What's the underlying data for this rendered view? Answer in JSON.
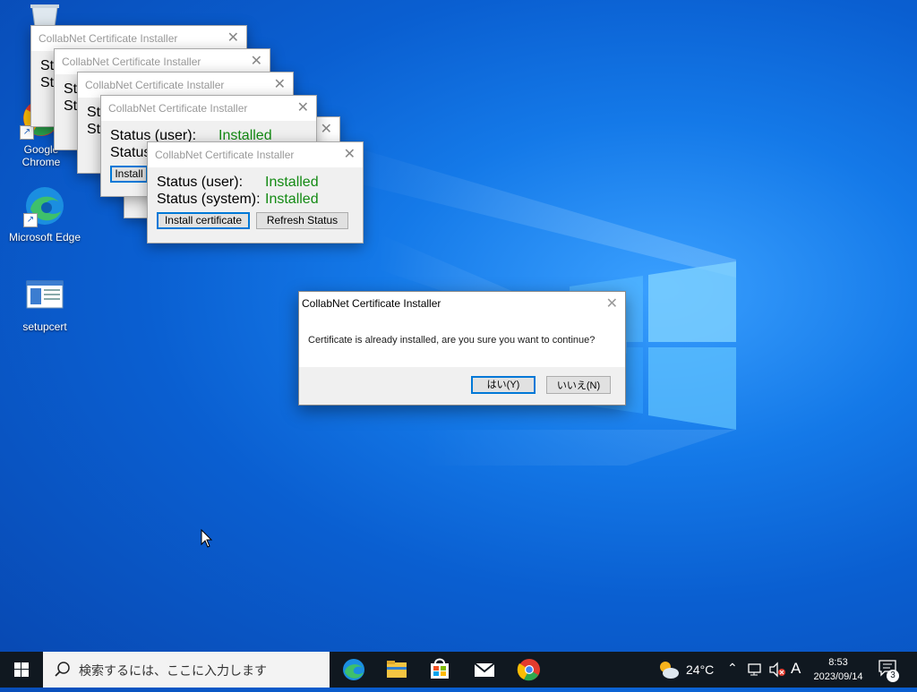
{
  "desktop": {
    "icons": [
      {
        "label": "Google Chrome"
      },
      {
        "label": "Microsoft Edge"
      },
      {
        "label": "setupcert"
      }
    ]
  },
  "installer": {
    "title": "CollabNet Certificate Installer",
    "status_user_label": "Status (user):",
    "status_system_label": "Status (system):",
    "status_user_value": "Installed",
    "status_system_value": "Installed",
    "install_button": "Install certificate",
    "refresh_button": "Refresh Status",
    "partial_st": "St",
    "partial_status_user": "Status (user):",
    "partial_status": "Status",
    "partial_in": "In",
    "partial_install": "Install"
  },
  "dialog": {
    "title": "CollabNet Certificate Installer",
    "message": "Certificate is already installed, are you sure you want to continue?",
    "yes_button": "はい(Y)",
    "no_button": "いいえ(N)"
  },
  "taskbar": {
    "search_placeholder": "検索するには、ここに入力します",
    "weather_temp": "24°C",
    "ime_indicator": "A",
    "time": "8:53",
    "date": "2023/09/14",
    "notification_count": "3",
    "pinned": [
      "edge-icon",
      "file-explorer-icon",
      "store-icon",
      "mail-icon",
      "chrome-icon"
    ]
  },
  "colors": {
    "installed_green": "#138a13",
    "focus_blue": "#0078d7",
    "taskbar": "#101820"
  }
}
